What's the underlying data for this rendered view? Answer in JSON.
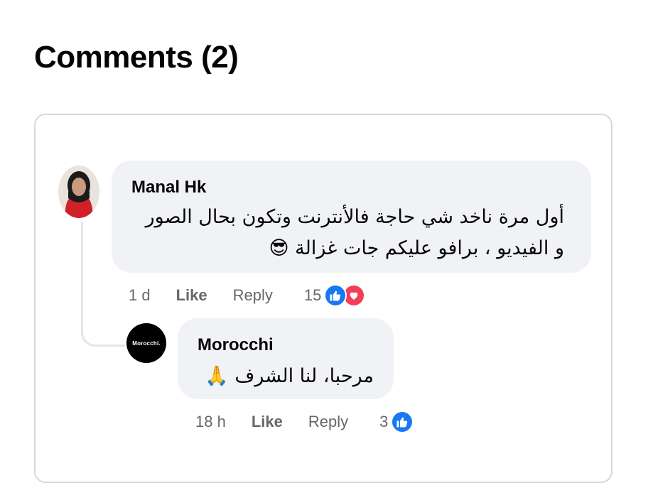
{
  "page": {
    "title": "Comments (2)"
  },
  "comments": [
    {
      "author": "Manal Hk",
      "text_line1": "أول مرة ناخد شي حاجة فالأنترنت وتكون بحال الصور",
      "text_line2": "و الفيديو ، برافو عليكم جات غزالة 😎",
      "time": "1 d",
      "like_label": "Like",
      "reply_label": "Reply",
      "reaction_count": "15",
      "reactions": [
        "like-icon",
        "love-icon"
      ],
      "colors": {
        "like": "#1877f2",
        "love": "#f33e58"
      }
    },
    {
      "author": "Morocchi",
      "avatar_text": "Morocchi.",
      "text": "مرحبا، لنا الشرف 🙏",
      "time": "18 h",
      "like_label": "Like",
      "reply_label": "Reply",
      "reaction_count": "3",
      "reactions": [
        "like-icon"
      ]
    }
  ]
}
